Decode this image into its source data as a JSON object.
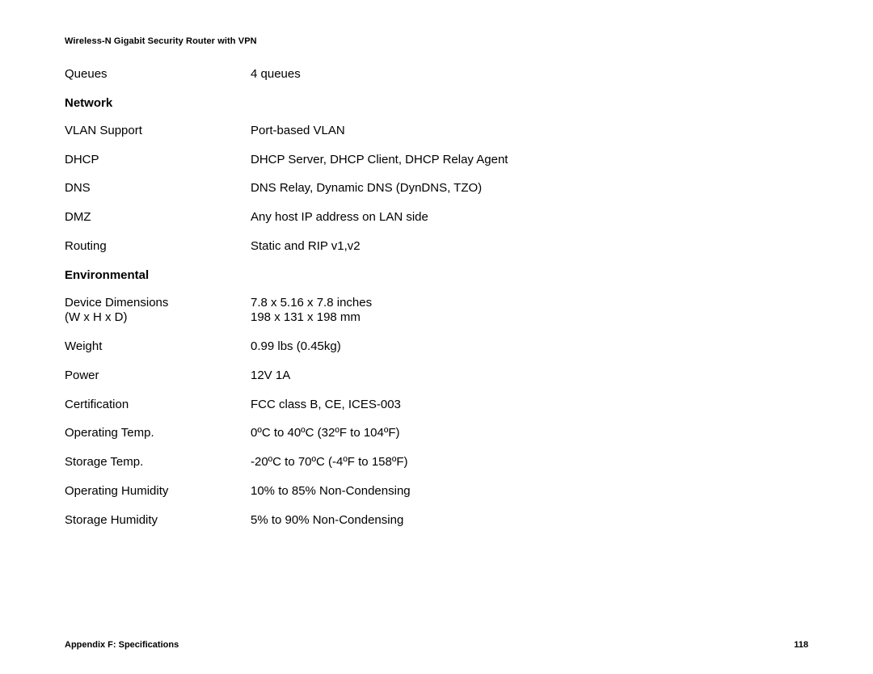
{
  "header": {
    "title": "Wireless-N Gigabit Security Router with VPN"
  },
  "specs": [
    {
      "type": "row",
      "label": "Queues",
      "value": "4 queues"
    },
    {
      "type": "section",
      "label": "Network"
    },
    {
      "type": "row",
      "label": "VLAN Support",
      "value": "Port-based VLAN"
    },
    {
      "type": "row",
      "label": "DHCP",
      "value": "DHCP Server, DHCP Client, DHCP Relay Agent"
    },
    {
      "type": "row",
      "label": "DNS",
      "value": "DNS Relay, Dynamic DNS (DynDNS, TZO)"
    },
    {
      "type": "row",
      "label": "DMZ",
      "value": "Any host IP address on LAN side"
    },
    {
      "type": "row",
      "label": "Routing",
      "value": "Static and RIP v1,v2"
    },
    {
      "type": "section",
      "label": "Environmental"
    },
    {
      "type": "row",
      "label": "Device Dimensions\n(W x H x D)",
      "value": "7.8 x 5.16 x 7.8 inches\n198 x 131 x 198 mm"
    },
    {
      "type": "row",
      "label": "Weight",
      "value": "0.99 lbs (0.45kg)"
    },
    {
      "type": "row",
      "label": "Power",
      "value": "12V 1A"
    },
    {
      "type": "row",
      "label": "Certification",
      "value": "FCC class B, CE, ICES-003"
    },
    {
      "type": "row",
      "label": "Operating Temp.",
      "value": "0ºC to 40ºC (32ºF to 104ºF)"
    },
    {
      "type": "row",
      "label": "Storage Temp.",
      "value": "-20ºC to 70ºC (-4ºF to 158ºF)"
    },
    {
      "type": "row",
      "label": "Operating Humidity",
      "value": "10% to 85% Non-Condensing"
    },
    {
      "type": "row",
      "label": "Storage Humidity",
      "value": "5% to 90% Non-Condensing"
    }
  ],
  "footer": {
    "appendix": "Appendix F: Specifications",
    "page": "118"
  }
}
